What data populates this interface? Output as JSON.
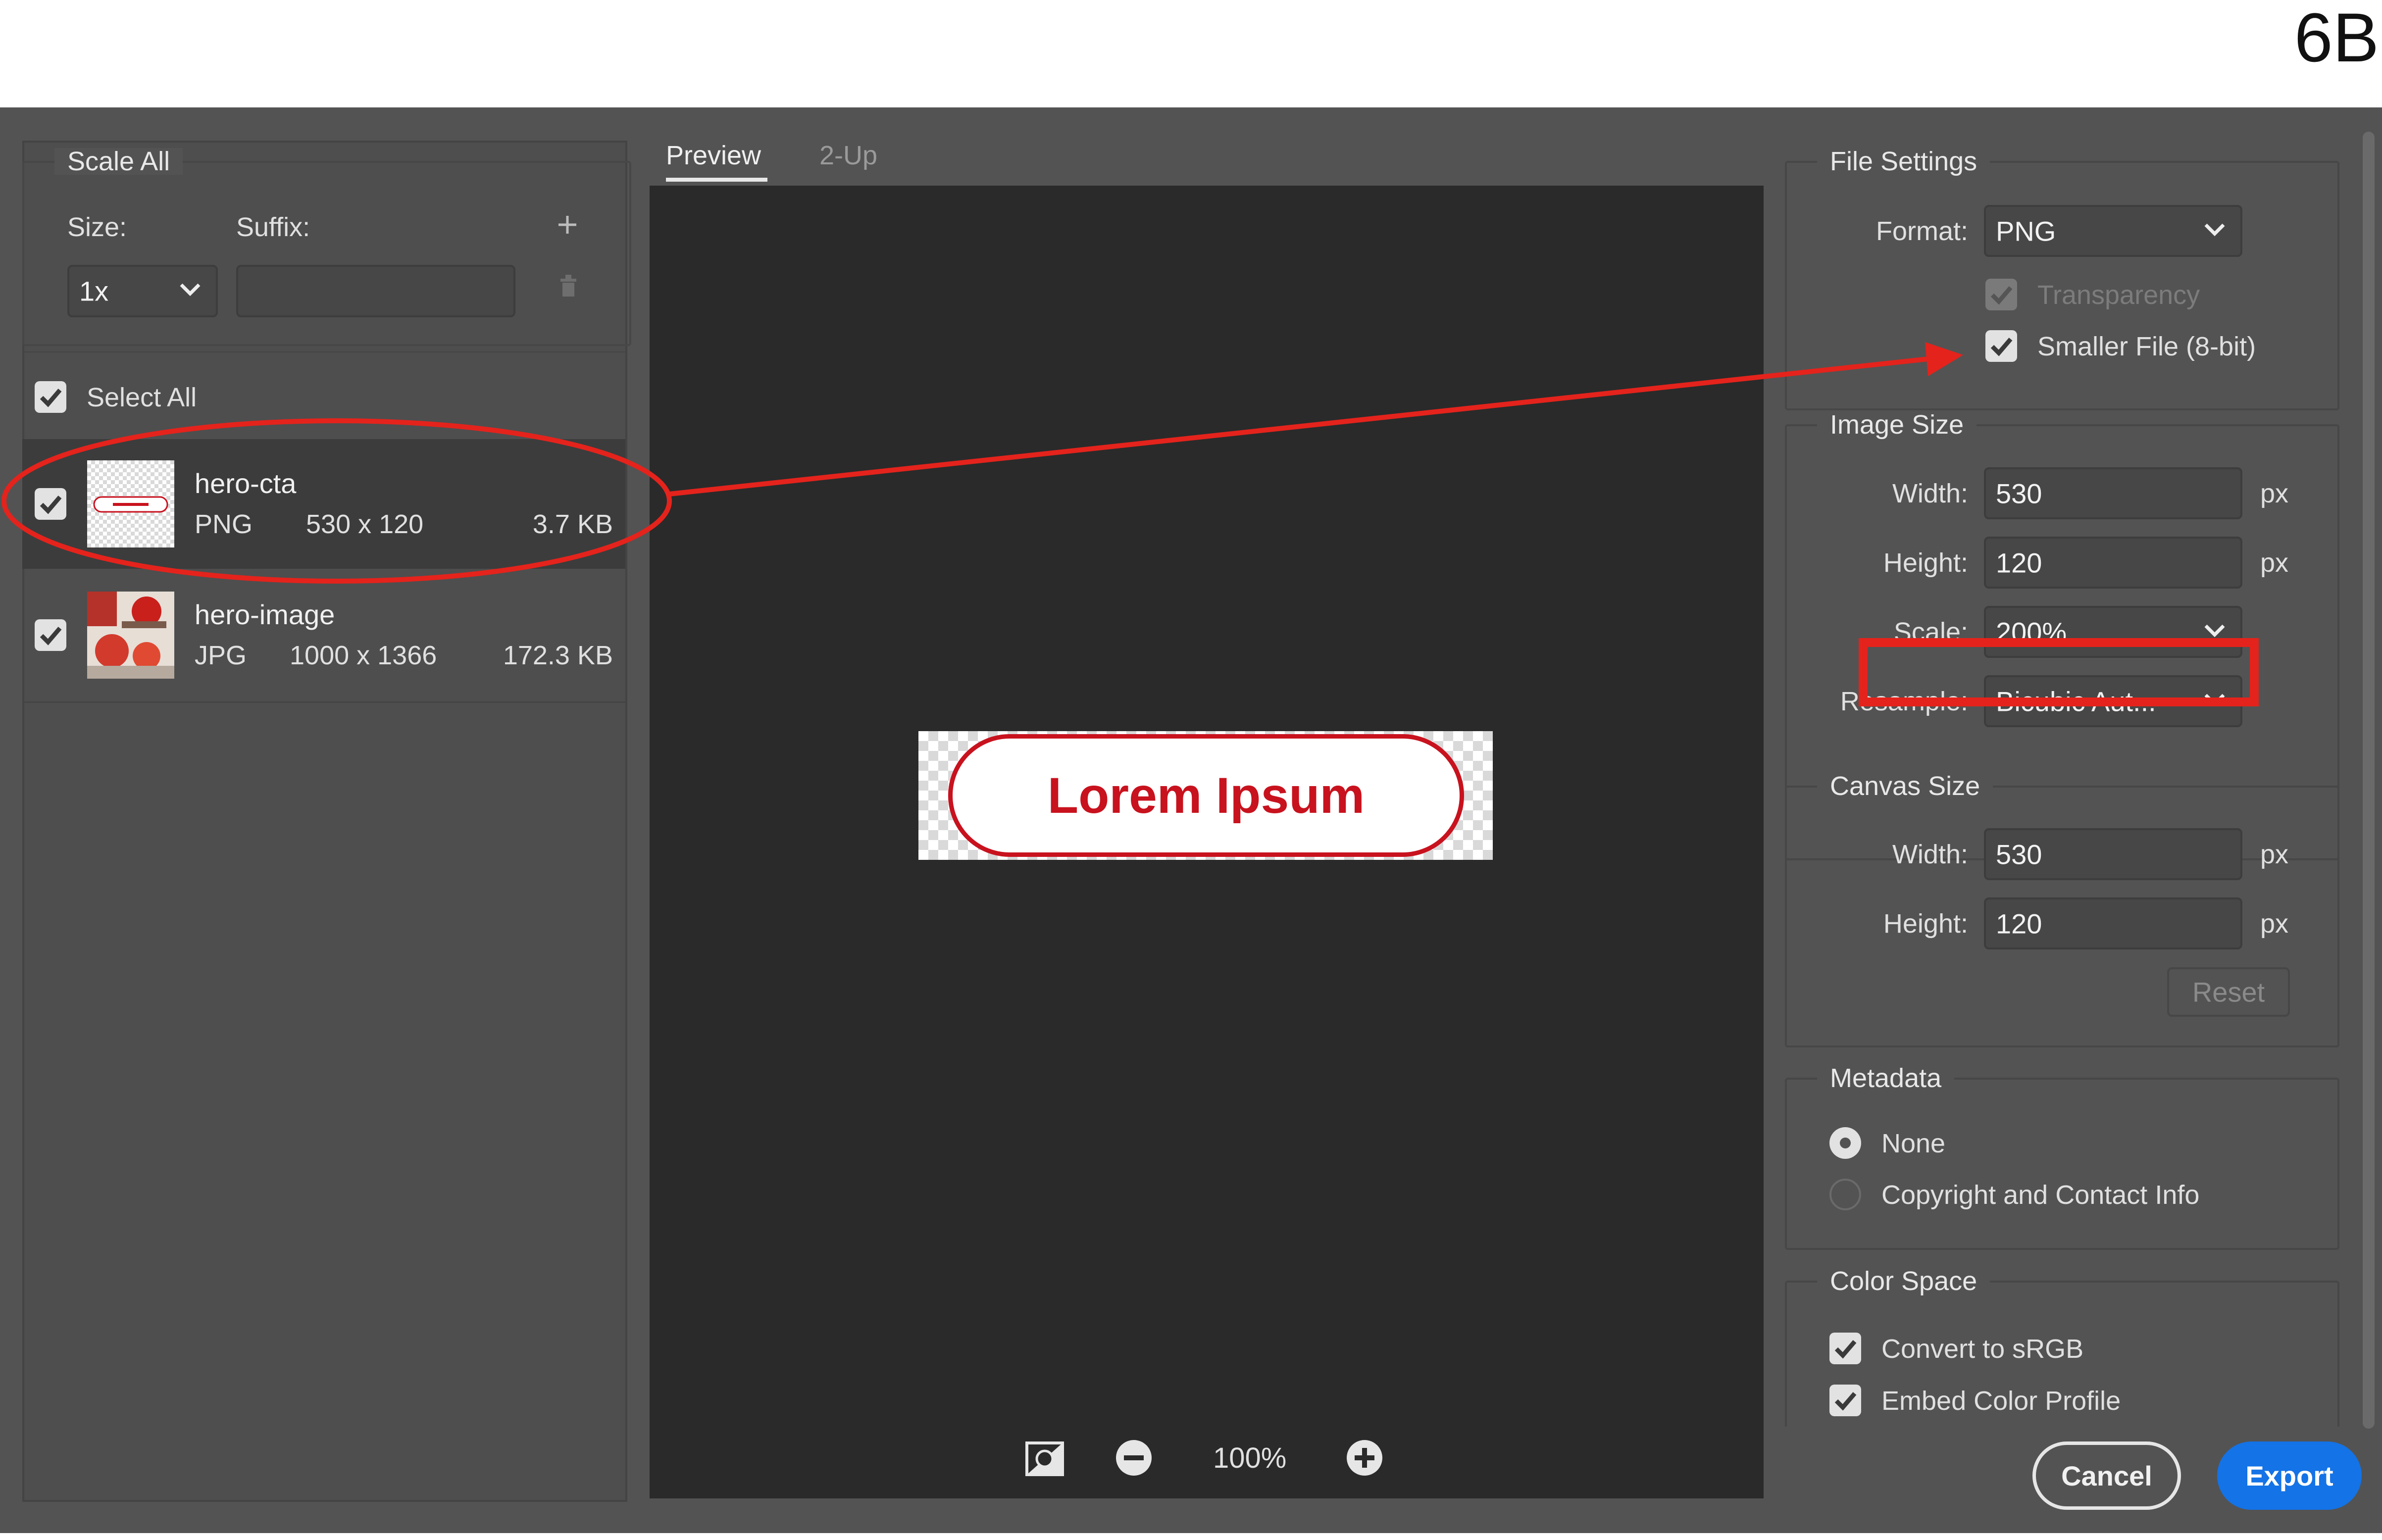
{
  "figure_label": "6B",
  "colors": {
    "dialog_bg": "#535353",
    "preview_bg": "#2a2a2a",
    "accent_blue": "#1473e6",
    "annotation_red": "#e4231c",
    "cta_red": "#c8121e"
  },
  "scale_all": {
    "title": "Scale All",
    "size_label": "Size:",
    "suffix_label": "Suffix:",
    "size_value": "1x",
    "suffix_value": "",
    "add_icon": "plus-icon",
    "delete_icon": "trash-icon"
  },
  "assets": {
    "select_all_label": "Select All",
    "select_all_checked": true,
    "items": [
      {
        "name": "hero-cta",
        "format": "PNG",
        "dimensions": "530 x 120",
        "size": "3.7 KB",
        "checked": true,
        "selected": true
      },
      {
        "name": "hero-image",
        "format": "JPG",
        "dimensions": "1000 x 1366",
        "size": "172.3 KB",
        "checked": true,
        "selected": false
      }
    ]
  },
  "preview": {
    "tabs": [
      {
        "label": "Preview",
        "active": true
      },
      {
        "label": "2-Up",
        "active": false
      }
    ],
    "cta_text": "Lorem Ipsum",
    "zoom": "100%",
    "toolbar_icons": [
      "toggle-background-icon",
      "zoom-out-icon",
      "zoom-in-icon"
    ]
  },
  "file_settings": {
    "title": "File Settings",
    "format_label": "Format:",
    "format_value": "PNG",
    "transparency_label": "Transparency",
    "transparency_checked": true,
    "transparency_disabled": true,
    "smaller_file_label": "Smaller File (8-bit)",
    "smaller_file_checked": true
  },
  "image_size": {
    "title": "Image Size",
    "width_label": "Width:",
    "width_value": "530",
    "height_label": "Height:",
    "height_value": "120",
    "unit": "px",
    "scale_label": "Scale:",
    "scale_value": "200%",
    "resample_label": "Resample:",
    "resample_value": "Bicubic Aut..."
  },
  "canvas_size": {
    "title": "Canvas Size",
    "width_label": "Width:",
    "width_value": "530",
    "height_label": "Height:",
    "height_value": "120",
    "unit": "px",
    "reset_label": "Reset"
  },
  "metadata": {
    "title": "Metadata",
    "options": [
      {
        "label": "None",
        "selected": true
      },
      {
        "label": "Copyright and Contact Info",
        "selected": false
      }
    ]
  },
  "color_space": {
    "title": "Color Space",
    "convert_label": "Convert to sRGB",
    "convert_checked": true,
    "embed_label": "Embed Color Profile",
    "embed_checked": true
  },
  "buttons": {
    "cancel": "Cancel",
    "export": "Export"
  }
}
